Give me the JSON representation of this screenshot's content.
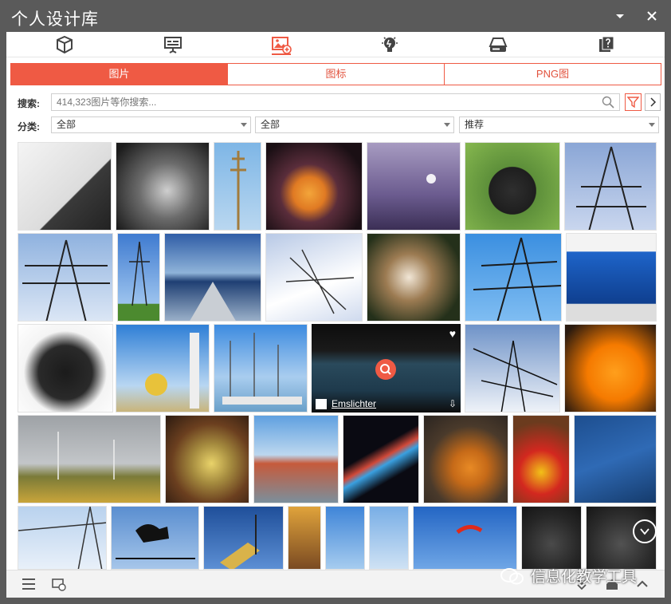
{
  "window": {
    "title": "个人设计库"
  },
  "top_tabs": [
    {
      "name": "3d-model",
      "icon": "cube-icon"
    },
    {
      "name": "presentation",
      "icon": "presentation-board-icon"
    },
    {
      "name": "images",
      "icon": "image-add-icon",
      "active": true
    },
    {
      "name": "ideas",
      "icon": "lightbulb-icon"
    },
    {
      "name": "storage",
      "icon": "drive-icon"
    },
    {
      "name": "help",
      "icon": "question-card-icon"
    }
  ],
  "sub_tabs": [
    {
      "label": "图片",
      "active": true
    },
    {
      "label": "图标",
      "active": false
    },
    {
      "label": "PNG图",
      "active": false
    }
  ],
  "search": {
    "label": "搜索:",
    "placeholder": "414,323图片等你搜索..."
  },
  "filter": {
    "label": "分类:",
    "select1": "全部",
    "select2": "全部",
    "select3": "推荐"
  },
  "hover_card": {
    "credit": "Emslichter"
  },
  "colors": {
    "accent": "#ef5a44",
    "titlebar": "#5a5a5a"
  },
  "watermark": {
    "text": "信息化教学工具"
  }
}
